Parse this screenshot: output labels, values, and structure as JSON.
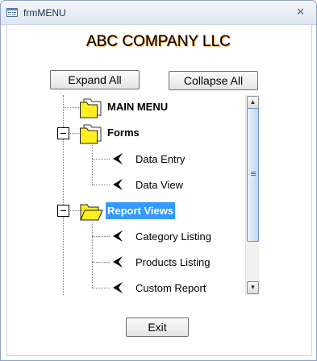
{
  "window": {
    "title": "frmMENU",
    "close_glyph": "✕"
  },
  "company_name": "ABC COMPANY LLC",
  "buttons": {
    "expand_all": "Expand All",
    "collapse_all": "Collapse All",
    "exit": "Exit"
  },
  "tree": {
    "main_menu": "MAIN MENU",
    "forms": {
      "label": "Forms",
      "children": [
        "Data Entry",
        "Data View"
      ]
    },
    "report_views": {
      "label": "Report Views",
      "children": [
        "Category Listing",
        "Products Listing",
        "Custom Report"
      ]
    }
  },
  "colors": {
    "selection": "#3399ff",
    "folder_yellow": "#ffef1f",
    "company_shadow": "#f1a34e"
  },
  "icons": [
    "app-icon",
    "close-icon",
    "folder-icon",
    "folder-open-icon",
    "arrow-icon",
    "collapse-icon",
    "scroll-up-icon",
    "scroll-down-icon"
  ]
}
